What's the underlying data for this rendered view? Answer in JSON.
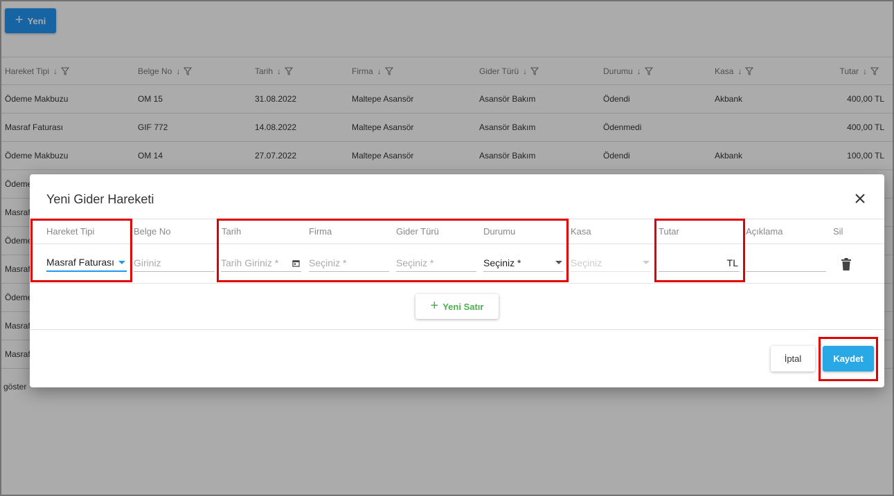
{
  "toolbar": {
    "new_label": "Yeni"
  },
  "grid": {
    "columns": [
      "Hareket Tipi",
      "Belge No",
      "Tarih",
      "Firma",
      "Gider Türü",
      "Durumu",
      "Kasa",
      "Tutar"
    ],
    "rows": [
      [
        "Ödeme Makbuzu",
        "OM 15",
        "31.08.2022",
        "Maltepe Asansör",
        "Asansör Bakım",
        "Ödendi",
        "Akbank",
        "400,00 TL"
      ],
      [
        "Masraf Faturası",
        "GIF 772",
        "14.08.2022",
        "Maltepe Asansör",
        "Asansör Bakım",
        "Ödenmedi",
        "",
        "400,00 TL"
      ],
      [
        "Ödeme Makbuzu",
        "OM 14",
        "27.07.2022",
        "Maltepe Asansör",
        "Asansör Bakım",
        "Ödendi",
        "Akbank",
        "100,00 TL"
      ],
      [
        "Ödeme",
        "",
        "",
        "",
        "",
        "",
        "",
        ""
      ],
      [
        "Masraf",
        "",
        "",
        "",
        "",
        "",
        "",
        ""
      ],
      [
        "Ödeme",
        "",
        "",
        "",
        "",
        "",
        "",
        ""
      ],
      [
        "Masraf",
        "",
        "",
        "",
        "",
        "",
        "",
        ""
      ],
      [
        "Ödeme",
        "",
        "",
        "",
        "",
        "",
        "",
        ""
      ],
      [
        "Masraf",
        "",
        "",
        "",
        "",
        "",
        "",
        ""
      ],
      [
        "Masraf",
        "",
        "",
        "",
        "",
        "",
        "",
        ""
      ]
    ],
    "pager_text": "göster"
  },
  "modal": {
    "title": "Yeni Gider Hareketi",
    "headers": {
      "hareket_tipi": "Hareket Tipi",
      "belge_no": "Belge No",
      "tarih": "Tarih",
      "firma": "Firma",
      "gider_turu": "Gider Türü",
      "durumu": "Durumu",
      "kasa": "Kasa",
      "tutar": "Tutar",
      "aciklama": "Açıklama",
      "sil": "Sil"
    },
    "row": {
      "hareket_tipi_value": "Masraf Faturası",
      "belge_no_placeholder": "Giriniz",
      "tarih_placeholder": "Tarih Giriniz *",
      "firma_placeholder": "Seçiniz *",
      "gider_turu_placeholder": "Seçiniz *",
      "durumu_value": "Seçiniz *",
      "kasa_placeholder": "Seçiniz",
      "tutar_suffix": "TL"
    },
    "add_row_label": "Yeni Satır",
    "cancel_label": "İptal",
    "save_label": "Kaydet"
  },
  "colors": {
    "accent": "#2196f3",
    "highlight": "#e00000",
    "add_row": "#4caf50"
  },
  "icons": [
    "plus-icon",
    "sort-arrow-icon",
    "filter-icon",
    "close-icon",
    "calendar-icon",
    "trash-icon",
    "chevron-down-icon"
  ]
}
